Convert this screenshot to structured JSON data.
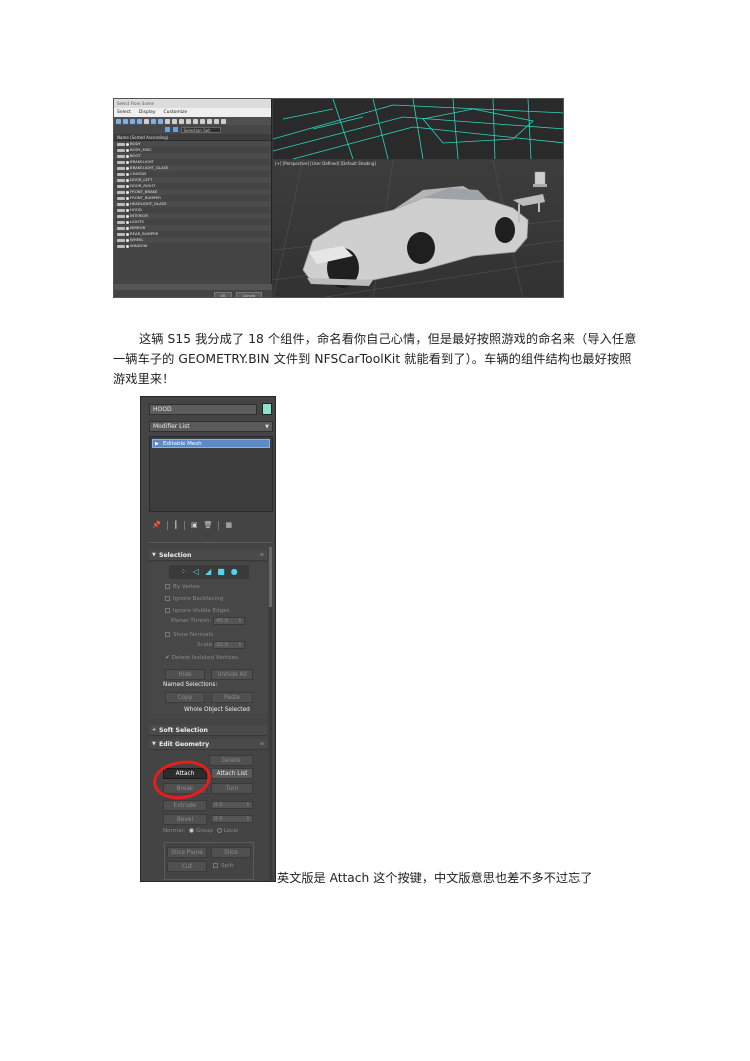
{
  "figure1": {
    "panel_title": "Select From Scene",
    "menu": [
      "Select",
      "Display",
      "Customize"
    ],
    "selection_set_label": "Selection Set:",
    "column_header": "Name (Sorted Ascending)",
    "objects": [
      "BODY",
      "BODY_MISC",
      "BOOT",
      "BRAKELIGHT",
      "BRAKELIGHT_GLASS",
      "CHASSIS",
      "DOOR_LEFT",
      "DOOR_RIGHT",
      "FRONT_BRAKE",
      "FRONT_BUMPER",
      "HEADLIGHT_GLASS",
      "HOOD",
      "INTERIOR",
      "LIGHTS",
      "MIRROR",
      "REAR_BUMPER",
      "WHEEL",
      "WINDOW"
    ],
    "ok_label": "OK",
    "cancel_label": "Cancel",
    "viewport_label": "[+] [Perspective] [User Defined] [Default Shading]"
  },
  "paragraph": "这辆 S15 我分成了 18 个组件，命名看你自己心情，但是最好按照游戏的命名来（导入任意一辆车子的 GEOMETRY.BIN 文件到 NFSCarToolKit 就能看到了）。车辆的组件结构也最好按照游戏里来！",
  "figure2": {
    "object_name": "HOOD",
    "object_color": "#8de0d0",
    "modifier_list": "Modifier List",
    "stack_item": "Editable Mesh",
    "divider_dots": "...",
    "selection": {
      "title": "Selection",
      "by_vertex": "By Vertex",
      "ignore_backfacing": "Ignore Backfacing",
      "ignore_visible_edges": "Ignore Visible Edges",
      "planar_thresh_label": "Planar Thresh:",
      "planar_thresh_value": "45.0",
      "show_normals": "Show Normals",
      "scale_label": "Scale:",
      "scale_value": "20.0",
      "delete_isolated": "Delete Isolated Vertices",
      "hide": "Hide",
      "unhide_all": "Unhide All",
      "named_selections": "Named Selections:",
      "copy": "Copy",
      "paste": "Paste",
      "status": "Whole Object Selected"
    },
    "soft_selection": {
      "title": "Soft Selection"
    },
    "edit_geometry": {
      "title": "Edit Geometry",
      "delete": "Delete",
      "attach": "Attach",
      "attach_list": "Attach List",
      "break": "Break",
      "turn": "Turn",
      "extrude": "Extrude",
      "extrude_value": "0.0",
      "bevel": "Bevel",
      "bevel_value": "0.0",
      "normal_label": "Normal:",
      "group": "Group",
      "local": "Local",
      "slice_plane": "Slice Plane",
      "slice": "Slice",
      "cut": "Cut",
      "split": "Split"
    }
  },
  "caption": "英文版是 Attach 这个按键，中文版意思也差不多不过忘了",
  "colors": {
    "highlight": "#ea1c1c",
    "accent_cyan": "#4fd6ea"
  }
}
